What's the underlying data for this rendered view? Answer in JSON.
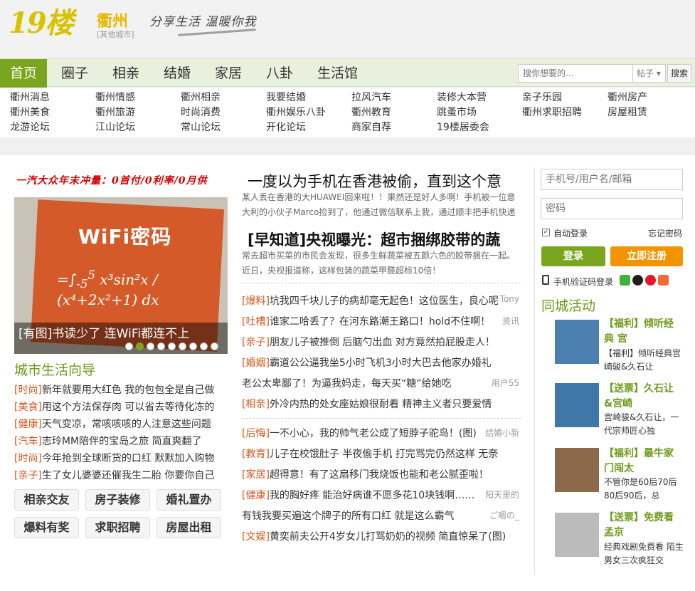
{
  "header": {
    "logo": "19楼",
    "city": "衢州",
    "city_sub": "[其他城市]",
    "slogan": "分享生活 温暖你我"
  },
  "nav": {
    "items": [
      "首页",
      "圈子",
      "相亲",
      "结婚",
      "家居",
      "八卦",
      "生活馆"
    ],
    "search_placeholder": "搜你想要的...",
    "search_type": "帖子",
    "search_button": "搜索"
  },
  "sublinks": [
    [
      "衢州消息",
      "衢州美食",
      "龙游论坛"
    ],
    [
      "衢州情感",
      "衢州旅游",
      "江山论坛"
    ],
    [
      "衢州相亲",
      "时尚消费",
      "常山论坛"
    ],
    [
      "我要结婚",
      "衢州娱乐八卦",
      "开化论坛"
    ],
    [
      "拉风汽车",
      "衢州教育",
      "商家自荐"
    ],
    [
      "装修大本营",
      "跳蚤市场",
      "19楼居委会"
    ],
    [
      "亲子乐园",
      "衢州求职招聘"
    ],
    [
      "衢州房产",
      "房屋租赁"
    ]
  ],
  "left": {
    "ad": "一汽大众年末冲量：0首付/0利率/0月供",
    "slide_heading": "WiFi密码",
    "slide_caption": "[有图]书读少了 连WiFi都连不上",
    "guide_title": "城市生活向导",
    "guide": [
      {
        "tag": "[时尚]",
        "text": "新年就要用大红色 我的包包全是自己做"
      },
      {
        "tag": "[美食]",
        "text": "用这个方法保存肉 可以省去等待化冻的"
      },
      {
        "tag": "[健康]",
        "text": "天气变凉，常咳咳咳的人注意这些问题"
      },
      {
        "tag": "[汽车]",
        "text": "志玲MM陪伴的宝岛之旅 简直爽翻了"
      },
      {
        "tag": "[时尚]",
        "text": "今年抢到全球断货的口红 默默加入购物"
      },
      {
        "tag": "[亲子]",
        "text": "生了女儿婆婆还催我生二胎 你要你自己"
      }
    ],
    "buttons": [
      "相亲交友",
      "房子装修",
      "婚礼置办",
      "爆料有奖",
      "求职招聘",
      "房屋出租"
    ]
  },
  "center": {
    "headline1": "一度以为手机在香港被偷，直到这个意",
    "summary1": "某人丢在香港的大HUAWEI回来啦！！果然还是好人多啊！手机被一位意大利的小伙子Marco捡到了，他通过微信联系上我，通过顺丰把手机快递",
    "headline2": "[早知道]央视曝光：超市捆绑胶带的蔬",
    "summary2": "常去超市买菜的市民会发现，很多生鲜蔬菜被五颜六色的胶带捆在一起。近日，央视报道称，这样包装的蔬菜甲醛超标10倍！",
    "group1": [
      {
        "tag": "[爆料]",
        "text": "坑我四千块儿子的病却毫无起色！这位医生，良心呢",
        "right": "Tony"
      },
      {
        "tag": "[吐槽]",
        "text": "谁家二哈丢了？在河东路潮王路口！hold不住啊！",
        "right": "资讯"
      },
      {
        "tag": "[亲子]",
        "text": "朋友儿子被推倒 后脑勺出血 对方竟然拍屁股走人！",
        "right": ""
      },
      {
        "tag": "[婚姻]",
        "text": "霸道公公逼我坐5小时飞机3小时大巴去他家办婚礼",
        "right": ""
      },
      {
        "tag": "",
        "text": "老公太卑鄙了！为逼我妈走，每天买“糖”给她吃",
        "right": "用户55"
      },
      {
        "tag": "[相亲]",
        "text": "外冷内热的处女座姑娘很耐看 精神主义者只要爱情",
        "right": ""
      }
    ],
    "group2": [
      {
        "tag": "[后悔]",
        "text": "一不小心，我的帅气老公成了短脖子驼鸟！(图)",
        "right": "结婚小新"
      },
      {
        "tag": "[教育]",
        "text": "儿子在校饿肚子 半夜偷手机 打完骂完仍然这样 无奈",
        "right": ""
      },
      {
        "tag": "[家居]",
        "text": "超得意！有了这扇移门我烧饭也能和老公腻歪啦！",
        "right": ""
      },
      {
        "tag": "[健康]",
        "text": "我的胸好疼 能治好病谁不愿多花10块钱啊……",
        "right": "阳天里的"
      },
      {
        "tag": "",
        "text": "有钱我要买遍这个牌子的所有口红 就是这么霸气",
        "right": "ご嗯の_"
      },
      {
        "tag": "[文娱]",
        "text": "黄奕前夫公开4岁女儿打骂奶奶的视频 简直惊呆了(图)",
        "right": ""
      }
    ]
  },
  "right": {
    "user_placeholder": "手机号/用户名/邮箱",
    "pwd_placeholder": "密码",
    "auto_login": "自动登录",
    "forgot": "忘记密码",
    "login": "登录",
    "register": "立即注册",
    "phone_login": "手机验证码登录",
    "activity_title": "同城活动",
    "activities": [
      {
        "title": "【福利】倾听经典 宫",
        "desc": "【福利】倾听经典宫崎骏&久石让",
        "thumb": "#4a7fae"
      },
      {
        "title": "【送票】久石让&宫崎",
        "desc": "宫崎骏&久石让，一代宗师匠心独",
        "thumb": "#3f77a8"
      },
      {
        "title": "【福利】最牛家门闯太",
        "desc": "不管你是60后70后80后90后，总",
        "thumb": "#8a6a4a"
      },
      {
        "title": "【送票】免费看孟京",
        "desc": "经典戏剧免费看 陌生男女三次疯狂交",
        "thumb": "#bbbbbb"
      }
    ]
  }
}
